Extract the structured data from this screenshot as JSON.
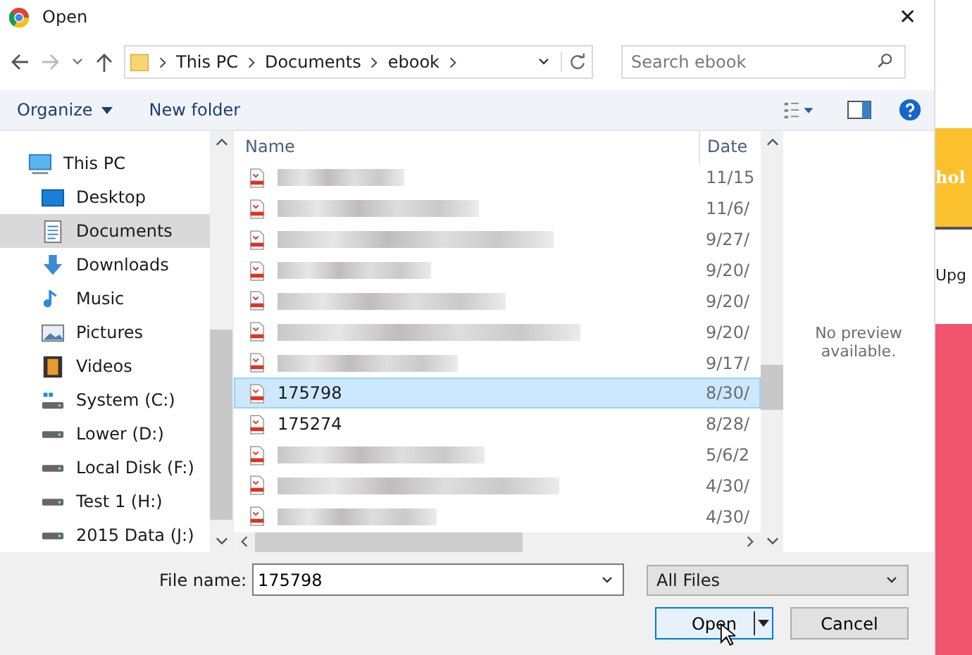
{
  "window": {
    "title": "Open",
    "close": "✕"
  },
  "address": {
    "crumbs": [
      "This PC",
      "Documents",
      "ebook"
    ]
  },
  "search": {
    "placeholder": "Search ebook"
  },
  "toolbar": {
    "organize": "Organize",
    "new_folder": "New folder"
  },
  "sidebar": {
    "items": [
      {
        "label": "This PC",
        "kind": "pc",
        "selected": false
      },
      {
        "label": "Desktop",
        "kind": "desktop",
        "selected": false
      },
      {
        "label": "Documents",
        "kind": "documents",
        "selected": true
      },
      {
        "label": "Downloads",
        "kind": "downloads",
        "selected": false
      },
      {
        "label": "Music",
        "kind": "music",
        "selected": false
      },
      {
        "label": "Pictures",
        "kind": "pictures",
        "selected": false
      },
      {
        "label": "Videos",
        "kind": "videos",
        "selected": false
      },
      {
        "label": "System (C:)",
        "kind": "system-drive",
        "selected": false
      },
      {
        "label": "Lower (D:)",
        "kind": "drive",
        "selected": false
      },
      {
        "label": "Local Disk (F:)",
        "kind": "drive",
        "selected": false
      },
      {
        "label": "Test 1 (H:)",
        "kind": "drive",
        "selected": false
      },
      {
        "label": "2015 Data (J:)",
        "kind": "drive",
        "selected": false
      }
    ]
  },
  "table": {
    "columns": [
      "Name",
      "Date"
    ],
    "rows": [
      {
        "kind": "blurred",
        "date": "11/15",
        "selected": false
      },
      {
        "kind": "blurred",
        "date": "11/6/",
        "selected": false
      },
      {
        "kind": "blurred",
        "date": "9/27/",
        "selected": false
      },
      {
        "kind": "blurred",
        "date": "9/20/",
        "selected": false
      },
      {
        "kind": "blurred",
        "date": "9/20/",
        "selected": false
      },
      {
        "kind": "blurred",
        "date": "9/20/",
        "selected": false
      },
      {
        "kind": "blurred",
        "date": "9/17/",
        "selected": false
      },
      {
        "kind": "file",
        "name": "175798",
        "date": "8/30/",
        "selected": true
      },
      {
        "kind": "file",
        "name": "175274",
        "date": "8/28/",
        "selected": false
      },
      {
        "kind": "blurred",
        "date": "5/6/2",
        "selected": false
      },
      {
        "kind": "blurred",
        "date": "4/30/",
        "selected": false
      },
      {
        "kind": "blurred",
        "date": "4/30/",
        "selected": false
      }
    ]
  },
  "preview": {
    "message": "No preview available."
  },
  "footer": {
    "file_name_label": "File name:",
    "file_name": "175798",
    "file_type": "All Files",
    "open": "Open",
    "cancel": "Cancel"
  },
  "background_page": {
    "banner": "hol",
    "heading": "Upg"
  }
}
